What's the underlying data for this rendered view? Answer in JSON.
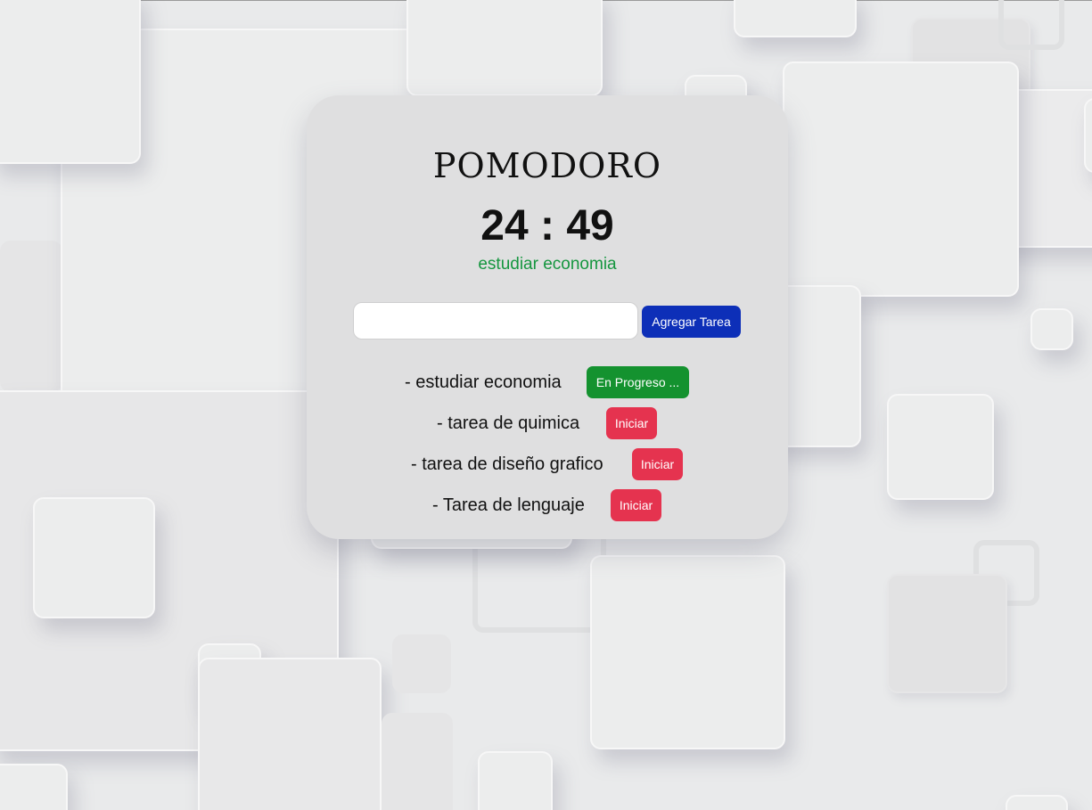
{
  "app": {
    "title": "POMODORO",
    "timer": "24 : 49",
    "current_task": "estudiar economia"
  },
  "form": {
    "input_value": "",
    "input_placeholder": "",
    "add_label": "Agregar Tarea"
  },
  "tasks": [
    {
      "label": "- estudiar economia",
      "action": "En Progreso ...",
      "status": "in-progress"
    },
    {
      "label": "- tarea de quimica",
      "action": "Iniciar",
      "status": "pending"
    },
    {
      "label": "- tarea de diseño grafico",
      "action": "Iniciar",
      "status": "pending"
    },
    {
      "label": "- Tarea de lenguaje",
      "action": "Iniciar",
      "status": "pending"
    }
  ],
  "colors": {
    "current_task": "#15963f",
    "add_button": "#0d2fb8",
    "in_progress_button": "#14922f",
    "start_button": "#e5334f"
  }
}
